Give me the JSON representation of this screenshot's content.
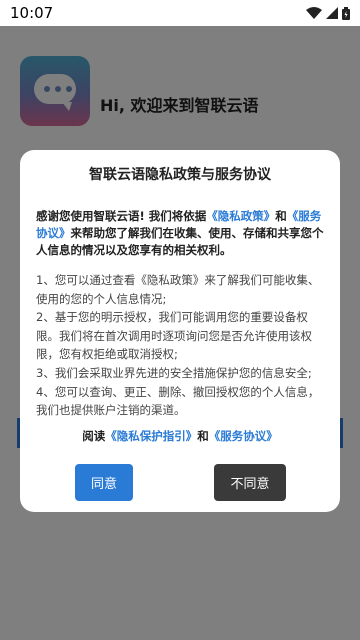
{
  "status_bar": {
    "time": "10:07"
  },
  "app": {
    "greeting": "Hi, 欢迎来到智联云语"
  },
  "dialog": {
    "title": "智联云语隐私政策与服务协议",
    "intro_part1": "感谢您使用智联云语! 我们将依据",
    "intro_link_privacy": "《隐私政策》",
    "intro_and": "和",
    "intro_link_service": "《服务协议》",
    "intro_part2": "来帮助您了解我们在收集、使用、存储和共享您个人信息的情况以及您享有的相关权利。",
    "items": [
      "1、您可以通过查看《隐私政策》来了解我们可能收集、使用的您的个人信息情况;",
      "2、基于您的明示授权，我们可能调用您的重要设备权限。我们将在首次调用时逐项询问您是否允许使用该权限，您有权拒绝或取消授权;",
      "3、我们会采取业界先进的安全措施保护您的信息安全;",
      "4、您可以查询、更正、删除、撤回授权您的个人信息，我们也提供账户注销的渠道。"
    ],
    "read_prefix": "阅读",
    "read_link_guide": "《隐私保护指引》",
    "read_and": "和",
    "read_link_service": "《服务协议》",
    "agree_label": "同意",
    "disagree_label": "不同意"
  }
}
